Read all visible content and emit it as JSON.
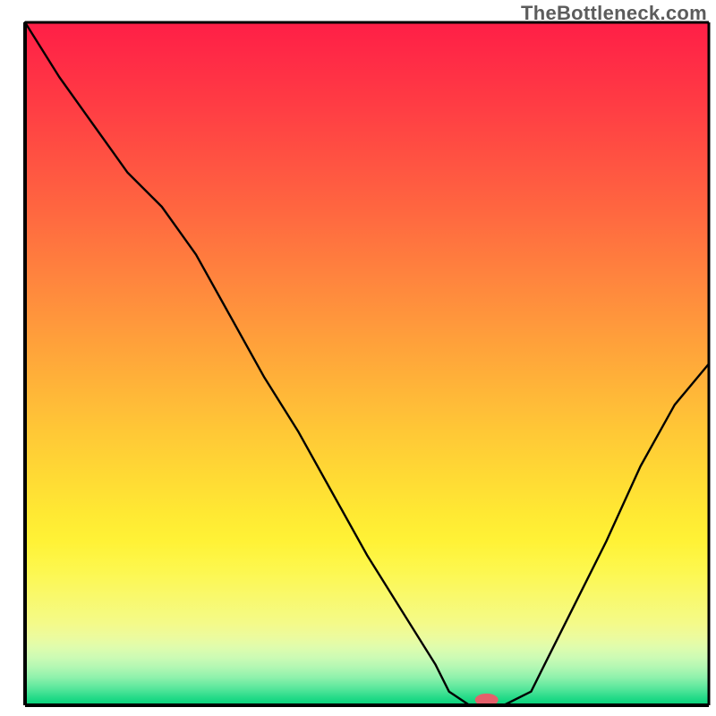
{
  "watermark": "TheBottleneck.com",
  "chart_data": {
    "type": "line",
    "title": "",
    "xlabel": "",
    "ylabel": "",
    "xlim": [
      0,
      100
    ],
    "ylim": [
      0,
      100
    ],
    "grid": false,
    "legend": false,
    "x": [
      0,
      5,
      10,
      15,
      20,
      25,
      30,
      35,
      40,
      45,
      50,
      55,
      60,
      62,
      65,
      70,
      74,
      76,
      80,
      85,
      90,
      95,
      100
    ],
    "values": [
      100,
      92,
      85,
      78,
      73,
      66,
      57,
      48,
      40,
      31,
      22,
      14,
      6,
      2,
      0,
      0,
      2,
      6,
      14,
      24,
      35,
      44,
      50
    ],
    "marker": {
      "x": 67.5,
      "y": 0.8,
      "color": "#e5606b",
      "rx": 6,
      "ry": 3
    },
    "gradient_stops": [
      {
        "offset": 0.0,
        "color": "#ff1f47"
      },
      {
        "offset": 0.04,
        "color": "#ff2846"
      },
      {
        "offset": 0.08,
        "color": "#ff3245"
      },
      {
        "offset": 0.12,
        "color": "#ff3c44"
      },
      {
        "offset": 0.16,
        "color": "#ff4743"
      },
      {
        "offset": 0.2,
        "color": "#ff5242"
      },
      {
        "offset": 0.24,
        "color": "#ff5d41"
      },
      {
        "offset": 0.28,
        "color": "#ff6840"
      },
      {
        "offset": 0.32,
        "color": "#ff743f"
      },
      {
        "offset": 0.36,
        "color": "#ff803e"
      },
      {
        "offset": 0.4,
        "color": "#ff8c3d"
      },
      {
        "offset": 0.44,
        "color": "#ff983c"
      },
      {
        "offset": 0.48,
        "color": "#ffa43a"
      },
      {
        "offset": 0.52,
        "color": "#ffb039"
      },
      {
        "offset": 0.56,
        "color": "#ffbc38"
      },
      {
        "offset": 0.6,
        "color": "#ffc836"
      },
      {
        "offset": 0.64,
        "color": "#ffd335"
      },
      {
        "offset": 0.68,
        "color": "#ffde34"
      },
      {
        "offset": 0.72,
        "color": "#ffe933"
      },
      {
        "offset": 0.76,
        "color": "#fff236"
      },
      {
        "offset": 0.8,
        "color": "#fdf74d"
      },
      {
        "offset": 0.84,
        "color": "#f9f96b"
      },
      {
        "offset": 0.88,
        "color": "#f4fa89"
      },
      {
        "offset": 0.9,
        "color": "#ecfb9e"
      },
      {
        "offset": 0.915,
        "color": "#dffcad"
      },
      {
        "offset": 0.93,
        "color": "#ccfbb4"
      },
      {
        "offset": 0.945,
        "color": "#b1f7b3"
      },
      {
        "offset": 0.96,
        "color": "#8cf1ab"
      },
      {
        "offset": 0.975,
        "color": "#5ae79c"
      },
      {
        "offset": 0.99,
        "color": "#21da87"
      },
      {
        "offset": 1.0,
        "color": "#05d079"
      }
    ]
  }
}
